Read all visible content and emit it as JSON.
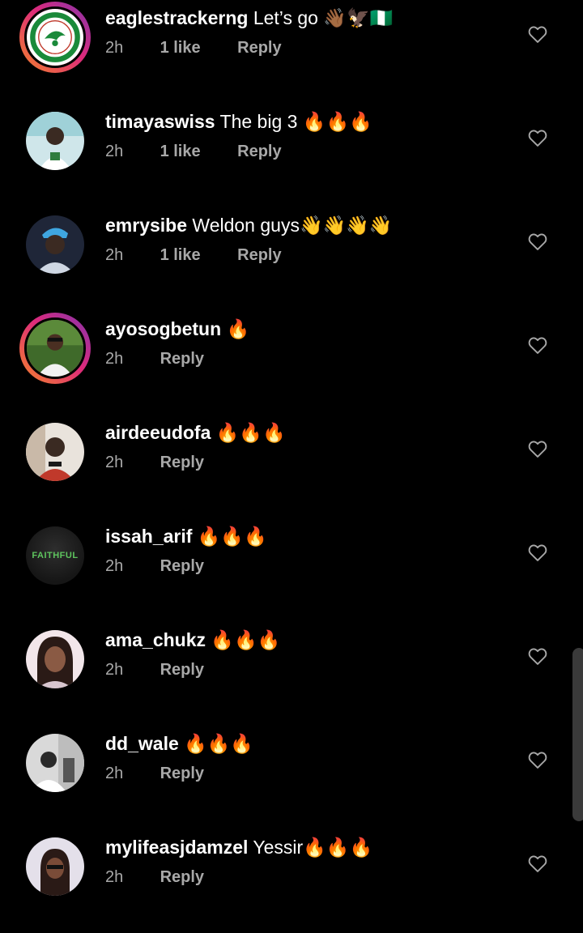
{
  "comments": [
    {
      "username": "eaglestrackerng",
      "text": "Let’s go 👋🏾🦅🇳🇬",
      "time": "2h",
      "likes": "1 like",
      "reply": "Reply",
      "avatar": "eagles-tracker-logo",
      "story_ring": true
    },
    {
      "username": "timayaswiss",
      "text": "The big 3 🔥🔥🔥",
      "time": "2h",
      "likes": "1 like",
      "reply": "Reply",
      "avatar": "profile-photo",
      "story_ring": false
    },
    {
      "username": "emrysibe",
      "text": "Weldon guys👋👋👋👋",
      "time": "2h",
      "likes": "1 like",
      "reply": "Reply",
      "avatar": "profile-photo",
      "story_ring": false
    },
    {
      "username": "ayosogbetun",
      "text": "🔥",
      "time": "2h",
      "likes": "",
      "reply": "Reply",
      "avatar": "profile-photo",
      "story_ring": true
    },
    {
      "username": "airdeeudofa",
      "text": "🔥🔥🔥",
      "time": "2h",
      "likes": "",
      "reply": "Reply",
      "avatar": "profile-photo",
      "story_ring": false
    },
    {
      "username": "issah_arif",
      "text": "🔥🔥🔥",
      "time": "2h",
      "likes": "",
      "reply": "Reply",
      "avatar": "faithful-logo",
      "avatar_text": "FAITHFUL",
      "story_ring": false
    },
    {
      "username": "ama_chukz",
      "text": "🔥🔥🔥",
      "time": "2h",
      "likes": "",
      "reply": "Reply",
      "avatar": "profile-photo",
      "story_ring": false
    },
    {
      "username": "dd_wale",
      "text": "🔥🔥🔥",
      "time": "2h",
      "likes": "",
      "reply": "Reply",
      "avatar": "profile-photo",
      "story_ring": false
    },
    {
      "username": "mylifeasjdamzel",
      "text": "Yessir🔥🔥🔥",
      "time": "2h",
      "likes": "",
      "reply": "Reply",
      "avatar": "profile-photo",
      "story_ring": false
    }
  ],
  "icons": {
    "like": "heart-outline-icon"
  },
  "colors": {
    "background": "#000000",
    "text": "#ffffff",
    "meta": "#a8a8a8",
    "story_ring_start": "#f58529",
    "story_ring_end": "#8134af",
    "faithful_green": "#5ec45e"
  }
}
